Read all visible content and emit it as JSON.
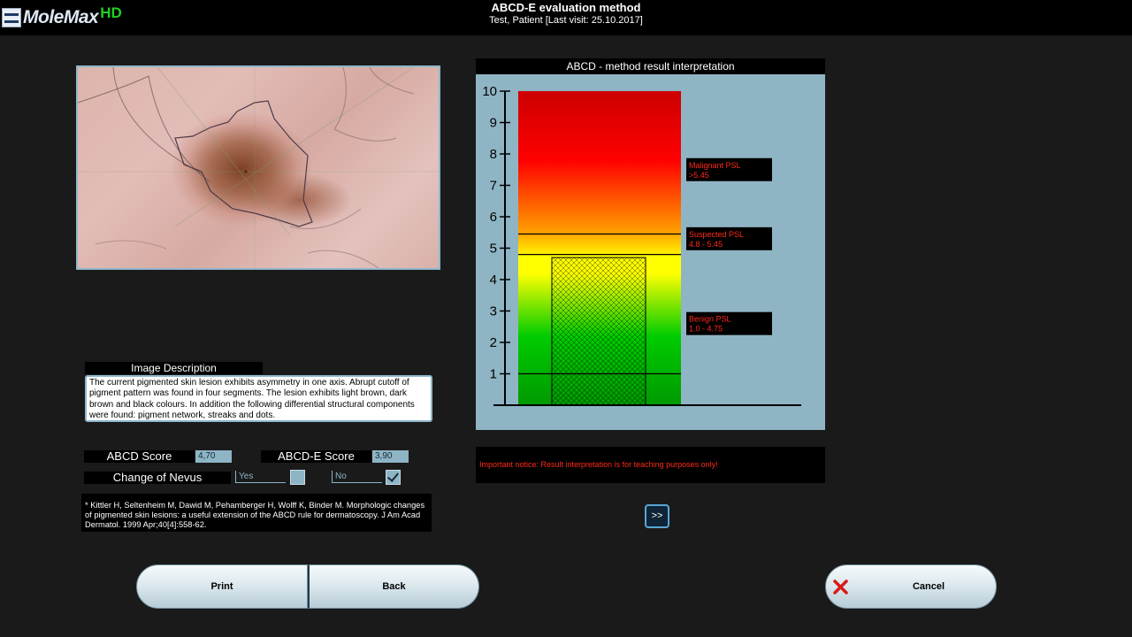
{
  "header": {
    "logo_text": "MoleMax",
    "logo_hd": "HD",
    "title": "ABCD-E evaluation method",
    "subtitle": "Test, Patient [Last visit: 25.10.2017]"
  },
  "description": {
    "header": "Image Description",
    "text": "The current pigmented skin lesion exhibits asymmetry in one axis. Abrupt cutoff of pigment pattern was found in four segments. The lesion exhibits light brown, dark brown and black colours. In addition the following differential structural components were found: pigment network, streaks and dots."
  },
  "scores": {
    "abcd_label": "ABCD Score",
    "abcd_value": "4,70",
    "abcde_label": "ABCD-E Score",
    "abcde_value": "3,90",
    "change_label": "Change of Nevus",
    "yes_label": "Yes",
    "no_label": "No",
    "yes_checked": false,
    "no_checked": true
  },
  "reference": "* Kittler H, Seltenheim M, Dawid M, Pehamberger H, Wolff K, Binder M. Morphologic changes of pigmented skin lesions: a useful extension of the ABCD rule for dermatoscopy. J Am Acad Dermatol. 1999 Apr;40[4]:558-62.",
  "chart_data": {
    "type": "bar",
    "title": "ABCD - method result interpretation",
    "ylim": [
      0,
      10
    ],
    "yticks": [
      "1",
      "2",
      "3",
      "4",
      "5",
      "6",
      "7",
      "8",
      "9",
      "10"
    ],
    "score": 4.7,
    "thresholds": [
      1.0,
      4.8,
      5.45
    ],
    "zones": [
      {
        "name": "Malignant PSL",
        "range": ">5.45",
        "at": 7.5
      },
      {
        "name": "Suspected PSL",
        "range": "4.8 - 5.45",
        "at": 5.3
      },
      {
        "name": "Benign PSL",
        "range": "1.0 - 4.75",
        "at": 2.6
      }
    ],
    "colors": {
      "bg": "#8fb5c5",
      "red": "#ff0000",
      "yellow": "#ffff00",
      "green": "#00cc00",
      "dark_green": "#009900",
      "label_text": "#ff2a1a"
    }
  },
  "notice": "Important notice: Result interpretation is for teaching purposes only!",
  "buttons": {
    "next": ">>",
    "print": "Print",
    "back": "Back",
    "cancel": "Cancel"
  }
}
